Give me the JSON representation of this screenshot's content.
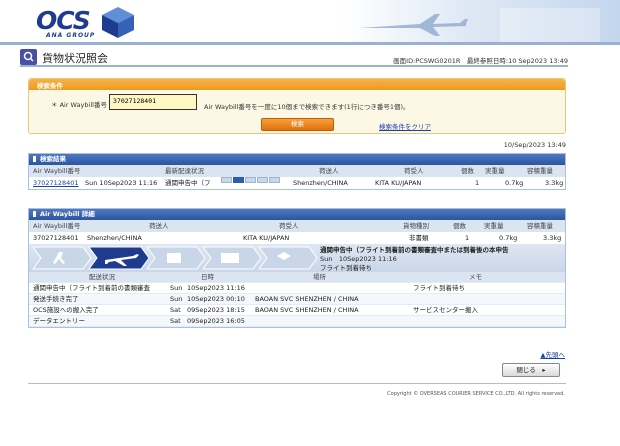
{
  "header": {
    "logo": "OCS",
    "logo_sub": "ANA GROUP"
  },
  "page": {
    "title": "貨物状況照会",
    "screen_id": "画面ID:PCSWG0201R　最終参照日時:10 Sep2023 13:49"
  },
  "search": {
    "section_title": "検索条件",
    "awb_label": "＊ Air Waybill番号 :",
    "awb_value": "37027128401",
    "help_text": "Air Waybill番号を一度に10個まで検索できます(1行につき番号1個)。",
    "search_button": "検索",
    "clear_link": "検索条件をクリア"
  },
  "date_line": "10/Sep/2023 13:49",
  "results": {
    "section_title": "検索結果",
    "columns": [
      "Air Waybill番号",
      "最新配達状況",
      "荷送人",
      "荷受人",
      "個数",
      "実重量",
      "容積重量"
    ],
    "row": {
      "awb": "37027128401",
      "date": "Sun  10Sep2023 11:16",
      "status": "通関申告中（フ",
      "shipper": "Shenzhen/CHINA",
      "consignee": "KITA KU/JAPAN",
      "pieces": "1",
      "weight": "0.7kg",
      "vol_weight": "3.3kg"
    }
  },
  "detail": {
    "section_title": "Air Waybill 詳細",
    "columns": [
      "Air Waybill番号",
      "荷送人",
      "荷受人",
      "貨物種別",
      "個数",
      "実重量",
      "容積重量"
    ],
    "row": {
      "awb": "37027128401",
      "shipper": "Shenzhen/CHINA",
      "consignee": "KITA KU/JAPAN",
      "type": "非書類",
      "pieces": "1",
      "weight": "0.7kg",
      "vol_weight": "3.3kg"
    },
    "status_main": "通関申告中（フライト到着前の書類審査中または到着後の本申告",
    "status_date": "Sun　10Sep2023 11:16",
    "status_note": "フライト到着待ち",
    "history_columns": [
      "配送状況",
      "日時",
      "場所",
      "メモ"
    ],
    "history": [
      {
        "status": "通関申告中（フライト到着前の書類審査",
        "day": "Sun",
        "datetime": "10Sep2023 11:16",
        "place": "",
        "memo": "フライト到着待ち"
      },
      {
        "status": "発送手続き完了",
        "day": "Sun",
        "datetime": "10Sep2023 00:10",
        "place": "BAOAN SVC SHENZHEN / CHINA",
        "memo": ""
      },
      {
        "status": "OCS施設への搬入完了",
        "day": "Sat",
        "datetime": "09Sep2023 18:15",
        "place": "BAOAN SVC SHENZHEN / CHINA",
        "memo": "サービスセンター搬入"
      },
      {
        "status": "データエントリー",
        "day": "Sat",
        "datetime": "09Sep2023 16:05",
        "place": "",
        "memo": ""
      }
    ]
  },
  "to_top": "▲先頭へ",
  "close_button": "閉じる　▸",
  "copyright": "Copyright © OVERSEAS COURIER SERVICE CO.,LTD. All rights reserved.",
  "colors": {
    "brand_blue": "#1f3b8f",
    "accent_orange": "#ef9a1c",
    "section_blue": "#2d559f"
  }
}
